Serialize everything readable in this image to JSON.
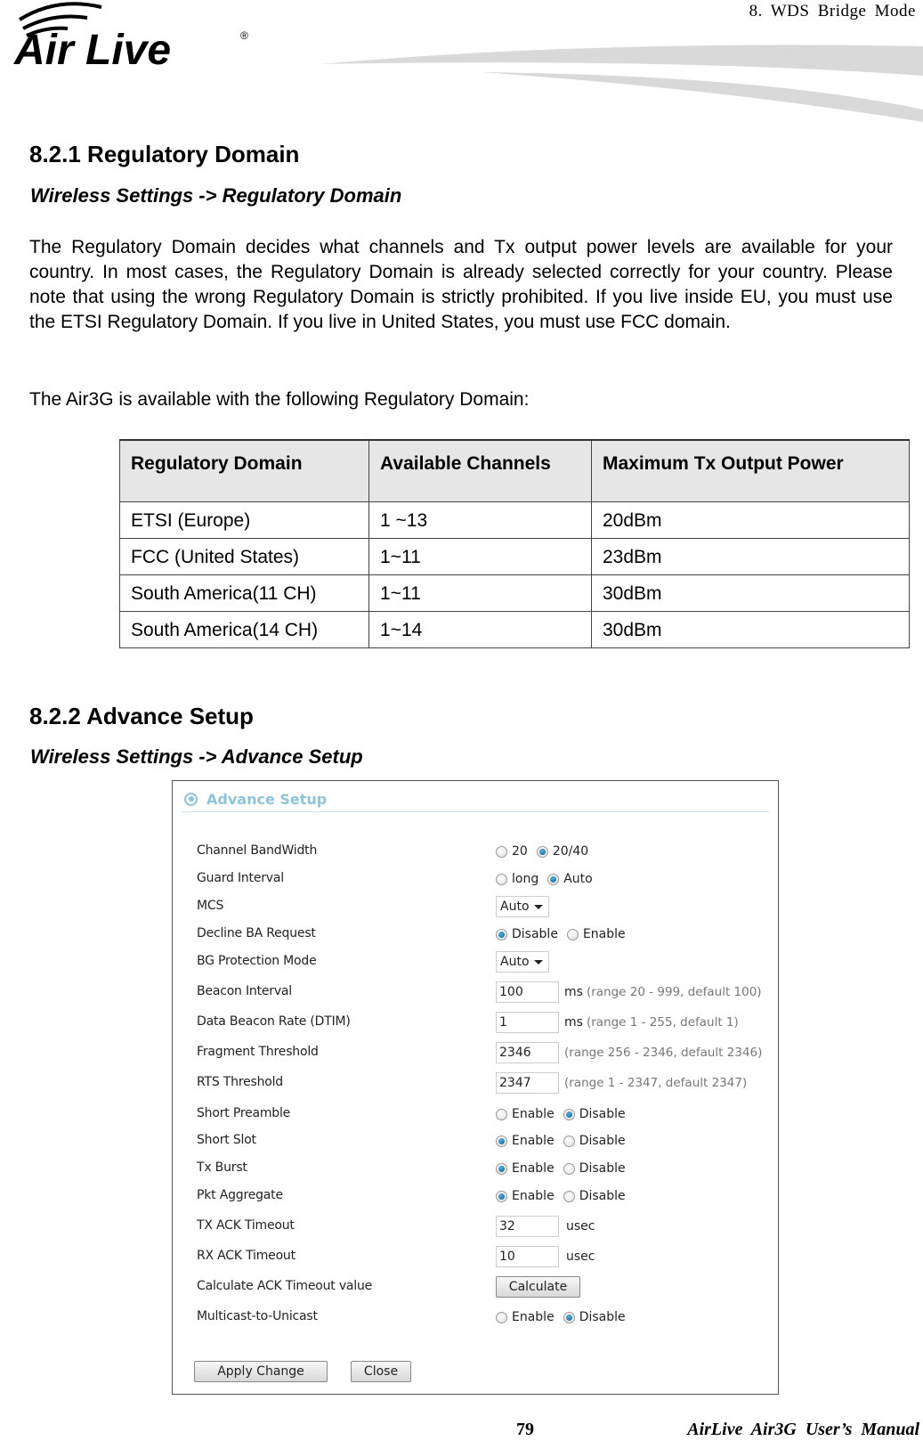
{
  "header": {
    "chapter": "8. WDS Bridge Mode",
    "logo_text": "Air Live",
    "logo_mark": "®"
  },
  "section1": {
    "title": "8.2.1 Regulatory Domain",
    "breadcrumb": "Wireless Settings -> Regulatory Domain",
    "paragraph1": "The Regulatory Domain decides what channels and Tx output power levels are available for your country.   In most cases, the Regulatory Domain is already selected correctly for your country.   Please note that using the wrong Regulatory Domain is strictly prohibited.   If you live inside EU, you must use the ETSI Regulatory Domain.   If you live in United States, you must use FCC domain.",
    "paragraph2": "The Air3G is available with the following Regulatory Domain:",
    "table": {
      "headers": [
        "Regulatory Domain",
        "Available Channels",
        "Maximum Tx Output Power"
      ],
      "rows": [
        [
          "ETSI (Europe)",
          "1 ~13",
          "20dBm"
        ],
        [
          "FCC (United States)",
          "1~11",
          "23dBm"
        ],
        [
          "South America(11 CH)",
          "1~11",
          "30dBm"
        ],
        [
          "South America(14 CH)",
          "1~14",
          "30dBm"
        ]
      ]
    }
  },
  "section2": {
    "title": "8.2.2 Advance Setup",
    "breadcrumb": "Wireless Settings -> Advance Setup"
  },
  "panel": {
    "title": "Advance Setup",
    "rows": {
      "channel_bandwidth": {
        "label": "Channel BandWidth",
        "options": [
          "20",
          "20/40"
        ],
        "selected": "20/40"
      },
      "guard_interval": {
        "label": "Guard Interval",
        "options": [
          "long",
          "Auto"
        ],
        "selected": "Auto"
      },
      "mcs": {
        "label": "MCS",
        "value": "Auto"
      },
      "decline_ba": {
        "label": "Decline BA Request",
        "options": [
          "Disable",
          "Enable"
        ],
        "selected": "Disable"
      },
      "bg_protection": {
        "label": "BG Protection Mode",
        "value": "Auto"
      },
      "beacon_interval": {
        "label": "Beacon Interval",
        "value": "100",
        "unit": "ms",
        "hint": "(range 20 - 999, default 100)"
      },
      "dtim": {
        "label": "Data Beacon Rate (DTIM)",
        "value": "1",
        "unit": "ms",
        "hint": "(range 1 - 255, default 1)"
      },
      "fragment_threshold": {
        "label": "Fragment Threshold",
        "value": "2346",
        "hint": "(range 256 - 2346, default 2346)"
      },
      "rts_threshold": {
        "label": "RTS Threshold",
        "value": "2347",
        "hint": "(range 1 - 2347, default 2347)"
      },
      "short_preamble": {
        "label": "Short Preamble",
        "options": [
          "Enable",
          "Disable"
        ],
        "selected": "Disable"
      },
      "short_slot": {
        "label": "Short Slot",
        "options": [
          "Enable",
          "Disable"
        ],
        "selected": "Enable"
      },
      "tx_burst": {
        "label": "Tx Burst",
        "options": [
          "Enable",
          "Disable"
        ],
        "selected": "Enable"
      },
      "pkt_aggregate": {
        "label": "Pkt Aggregate",
        "options": [
          "Enable",
          "Disable"
        ],
        "selected": "Enable"
      },
      "tx_ack_timeout": {
        "label": "TX ACK Timeout",
        "value": "32",
        "unit": "usec"
      },
      "rx_ack_timeout": {
        "label": "RX ACK Timeout",
        "value": "10",
        "unit": "usec"
      },
      "calc_ack": {
        "label": "Calculate ACK Timeout value",
        "button": "Calculate"
      },
      "multicast_unicast": {
        "label": "Multicast-to-Unicast",
        "options": [
          "Enable",
          "Disable"
        ],
        "selected": "Disable"
      }
    },
    "buttons": {
      "apply": "Apply Change",
      "close": "Close"
    }
  },
  "footer": {
    "page_number": "79",
    "manual_title": "AirLive Air3G User’s Manual"
  }
}
